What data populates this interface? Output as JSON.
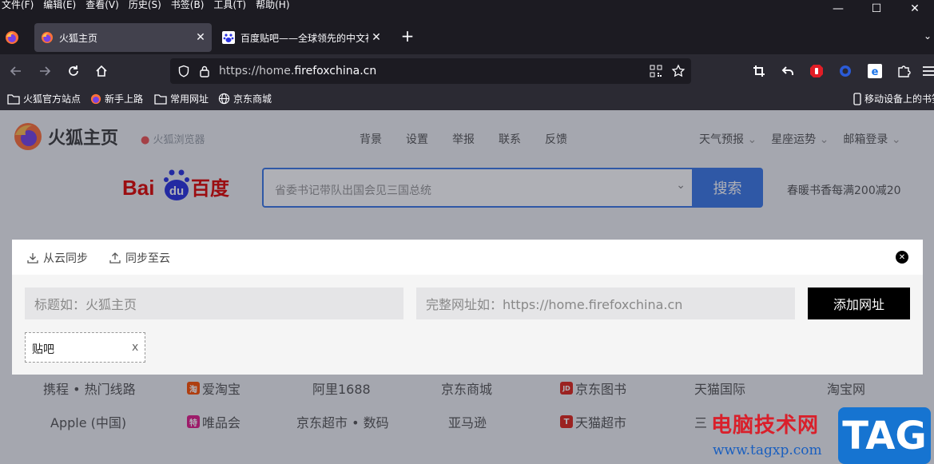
{
  "menubar": {
    "items": [
      "文件(F)",
      "编辑(E)",
      "查看(V)",
      "历史(S)",
      "书签(B)",
      "工具(T)",
      "帮助(H)"
    ]
  },
  "window_controls": {
    "minimize": "—",
    "maximize": "☐",
    "close": "✕"
  },
  "tabs": [
    {
      "title": "火狐主页",
      "icon": "firefox-icon",
      "active": true
    },
    {
      "title": "百度贴吧——全球领先的中文社",
      "icon": "baidu-paw-icon",
      "active": false
    }
  ],
  "tab_close": "✕",
  "new_tab": "+",
  "navbar": {
    "url_prefix": "https://home.",
    "url_domain": "firefoxchina.cn"
  },
  "bookmarks": [
    {
      "label": "火狐官方站点",
      "icon": "folder-icon"
    },
    {
      "label": "新手上路",
      "icon": "firefox-icon"
    },
    {
      "label": "常用网址",
      "icon": "folder-icon"
    },
    {
      "label": "京东商城",
      "icon": "globe-icon"
    }
  ],
  "bookmarks_right": "移动设备上的书签",
  "page": {
    "logo_text": "火狐主页",
    "brand_sub": "火狐浏览器",
    "topnav": [
      "背景",
      "设置",
      "举报",
      "联系",
      "反馈"
    ],
    "topright": [
      "天气预报",
      "星座运势",
      "邮箱登录"
    ],
    "baidu_left": "Bai",
    "baidu_du": "du",
    "baidu_right": "百度",
    "search_placeholder": "省委书记带队出国会见三国总统",
    "search_button": "搜索",
    "promo": "春暖书香每满200减20",
    "grid": [
      [
        {
          "label": "携程 • 热门线路",
          "icon": null
        },
        {
          "label": "爱淘宝",
          "icon": "淘"
        },
        {
          "label": "阿里1688",
          "icon": null
        },
        {
          "label": "京东商城",
          "icon": null
        },
        {
          "label": "京东图书",
          "icon": "JD"
        },
        {
          "label": "天猫国际",
          "icon": null
        },
        {
          "label": "淘宝网",
          "icon": null
        }
      ],
      [
        {
          "label": "Apple (中国)",
          "icon": null
        },
        {
          "label": "唯品会",
          "icon": "特"
        },
        {
          "label": "京东超市 • 数码",
          "icon": null
        },
        {
          "label": "亚马逊",
          "icon": null
        },
        {
          "label": "天猫超市",
          "icon": "T"
        },
        {
          "label": "三",
          "icon": null
        }
      ]
    ]
  },
  "modal": {
    "sync_from_cloud": "从云同步",
    "sync_to_cloud": "同步至云",
    "close": "✕",
    "title_placeholder": "标题如：火狐主页",
    "url_placeholder": "完整网址如：https://home.firefoxchina.cn",
    "add_button": "添加网址",
    "tags": [
      {
        "label": "贴吧",
        "remove": "x"
      }
    ]
  },
  "watermark": {
    "title": "电脑技术网",
    "url": "www.tagxp.com",
    "badge": "TAG"
  },
  "colors": {
    "chrome_dark": "#1c1b22",
    "toolbar": "#2b2a33",
    "active_tab": "#42414d",
    "baidu_blue": "#3b78e7",
    "baidu_red": "#e10602",
    "watermark_red": "#d9202b",
    "watermark_blue": "#1674d1"
  }
}
